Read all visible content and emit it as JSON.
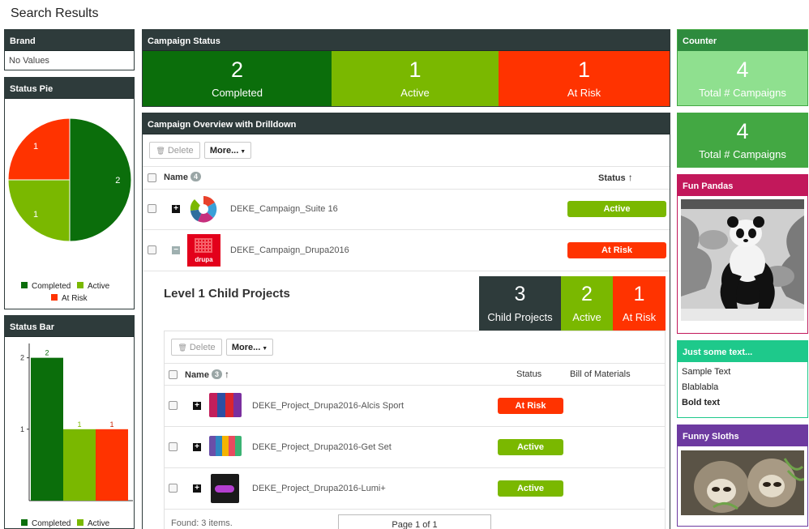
{
  "page": {
    "title": "Search Results"
  },
  "colors": {
    "dark_green": "#0b6e0b",
    "green": "#7ab800",
    "red": "#ff3300",
    "header": "#2e3b3b",
    "light_green": "#8fe08f",
    "counter_green": "#43a843",
    "magenta": "#c2185b",
    "teal": "#1ec98b",
    "purple": "#6d3aa0"
  },
  "brand": {
    "title": "Brand",
    "value": "No Values"
  },
  "status_pie": {
    "title": "Status Pie",
    "legend": [
      "Completed",
      "Active",
      "At Risk"
    ]
  },
  "status_bar": {
    "title": "Status Bar",
    "legend": [
      "Completed",
      "Active"
    ]
  },
  "campaign_status": {
    "title": "Campaign Status",
    "tiles": [
      {
        "num": "2",
        "label": "Completed"
      },
      {
        "num": "1",
        "label": "Active"
      },
      {
        "num": "1",
        "label": "At Risk"
      }
    ]
  },
  "counter": {
    "title": "Counter",
    "num": "4",
    "label": "Total # Campaigns"
  },
  "counter2": {
    "num": "4",
    "label": "Total # Campaigns"
  },
  "overview": {
    "title": "Campaign Overview with Drilldown",
    "delete": "Delete",
    "more": "More...",
    "col_name": "Name",
    "name_count": "4",
    "col_status": "Status",
    "rows": [
      {
        "name": "DEKE_Campaign_Suite 16",
        "status": "Active",
        "expand": "+"
      },
      {
        "name": "DEKE_Campaign_Drupa2016",
        "status": "At Risk",
        "expand": "−",
        "logo": "drupa"
      }
    ]
  },
  "child": {
    "title": "Level 1 Child Projects",
    "tiles": [
      {
        "num": "3",
        "label": "Child Projects"
      },
      {
        "num": "2",
        "label": "Active"
      },
      {
        "num": "1",
        "label": "At Risk"
      }
    ],
    "delete": "Delete",
    "more": "More...",
    "col_name": "Name",
    "name_count": "3",
    "col_status": "Status",
    "col_bom": "Bill of Materials",
    "rows": [
      {
        "name": "DEKE_Project_Drupa2016-Alcis Sport",
        "status": "At Risk"
      },
      {
        "name": "DEKE_Project_Drupa2016-Get Set",
        "status": "Active"
      },
      {
        "name": "DEKE_Project_Drupa2016-Lumi+",
        "status": "Active"
      }
    ],
    "found": "Found: 3 items.",
    "page": "Page 1 of 1"
  },
  "fun_pandas": {
    "title": "Fun Pandas"
  },
  "text_panel": {
    "title": "Just some text...",
    "lines": [
      "Sample Text",
      "Blablabla"
    ],
    "bold": "Bold text"
  },
  "funny_sloths": {
    "title": "Funny Sloths"
  },
  "chart_data": [
    {
      "type": "pie",
      "title": "Status Pie",
      "categories": [
        "Completed",
        "Active",
        "At Risk"
      ],
      "values": [
        2,
        1,
        1
      ],
      "colors": [
        "#0b6e0b",
        "#7ab800",
        "#ff3300"
      ]
    },
    {
      "type": "bar",
      "title": "Status Bar",
      "categories": [
        "Completed",
        "Active",
        "At Risk"
      ],
      "values": [
        2,
        1,
        1
      ],
      "ylim": [
        0,
        2.2
      ],
      "yticks": [
        1,
        2
      ],
      "colors": [
        "#0b6e0b",
        "#7ab800",
        "#ff3300"
      ]
    }
  ]
}
